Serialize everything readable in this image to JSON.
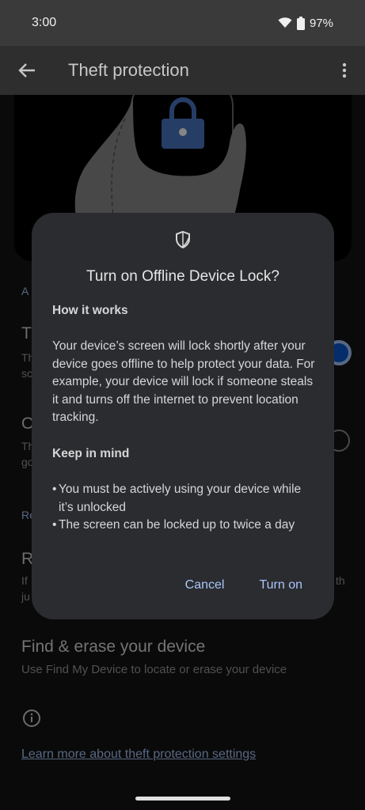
{
  "status_bar": {
    "time": "3:00",
    "battery": "97%",
    "icons": [
      "wifi-icon",
      "battery-icon"
    ]
  },
  "app_bar": {
    "title": "Theft protection",
    "icons": [
      "back-arrow-icon",
      "more-vert-icon"
    ]
  },
  "background": {
    "partial_link_1": "A",
    "item_1_title": "T",
    "item_1_sub_1": "Th",
    "item_1_sub_2": "sc",
    "item_2_title": "O",
    "item_2_sub_1": "Th",
    "item_2_sub_2": "go",
    "partial_link_2": "Re",
    "item_3_title": "R",
    "item_3_sub_1": "If",
    "item_3_sub_2": "ju",
    "item_3_sub_right": "th",
    "find_title": "Find & erase your device",
    "find_sub": "Use Find My Device to locate or erase your device",
    "learn_more": "Learn more about theft protection settings"
  },
  "dialog": {
    "title": "Turn on Offline Device Lock?",
    "how_heading": "How it works",
    "how_body": "Your device’s screen will lock shortly after your device goes offline to help protect your data. For example, your device will lock if someone steals it and turns off the internet to prevent location tracking.",
    "keep_heading": "Keep in mind",
    "bullets": [
      "You must be actively using your device while it’s unlocked",
      "The screen can be locked up to twice a day"
    ],
    "cancel_label": "Cancel",
    "turn_on_label": "Turn on"
  },
  "colors": {
    "accent": "#a8c7fa",
    "dialog_bg": "#2b2c30",
    "app_bar_bg": "#2e2e2e"
  }
}
